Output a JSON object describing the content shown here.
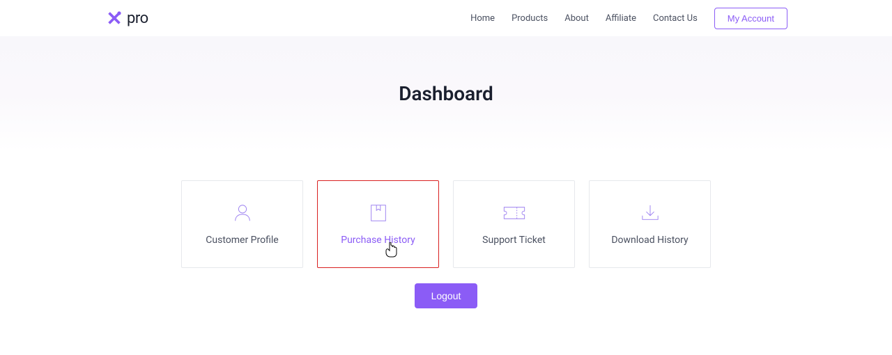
{
  "logo": {
    "text": "pro"
  },
  "nav": {
    "items": [
      {
        "label": "Home"
      },
      {
        "label": "Products"
      },
      {
        "label": "About"
      },
      {
        "label": "Affiliate"
      },
      {
        "label": "Contact Us"
      }
    ],
    "account_label": "My Account"
  },
  "hero": {
    "title": "Dashboard"
  },
  "cards": [
    {
      "label": "Customer Profile"
    },
    {
      "label": "Purchase History"
    },
    {
      "label": "Support Ticket"
    },
    {
      "label": "Download History"
    }
  ],
  "logout_label": "Logout",
  "colors": {
    "accent": "#8b5cf6",
    "highlight_border": "#d92020"
  }
}
